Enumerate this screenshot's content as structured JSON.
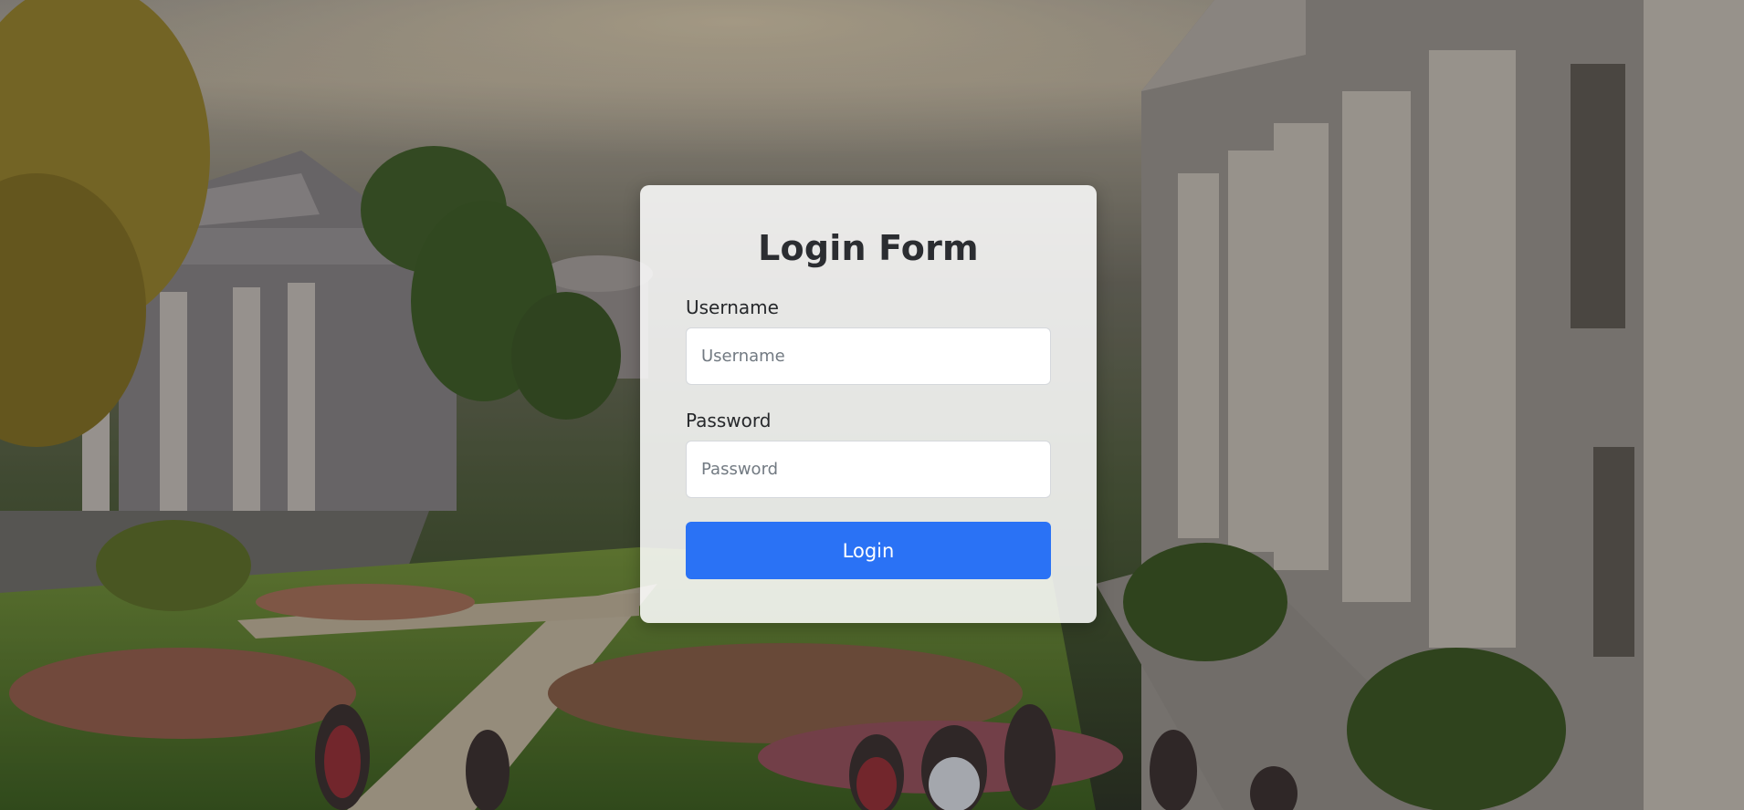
{
  "login_form": {
    "title": "Login Form",
    "username_label": "Username",
    "username_placeholder": "Username",
    "username_value": "",
    "password_label": "Password",
    "password_placeholder": "Password",
    "password_value": "",
    "submit_label": "Login"
  },
  "theme": {
    "accent": "#2a72f5",
    "card_background": "#ffffff",
    "title_color": "#2b2d31"
  },
  "background": {
    "description_icon": "campus-scene-image"
  }
}
